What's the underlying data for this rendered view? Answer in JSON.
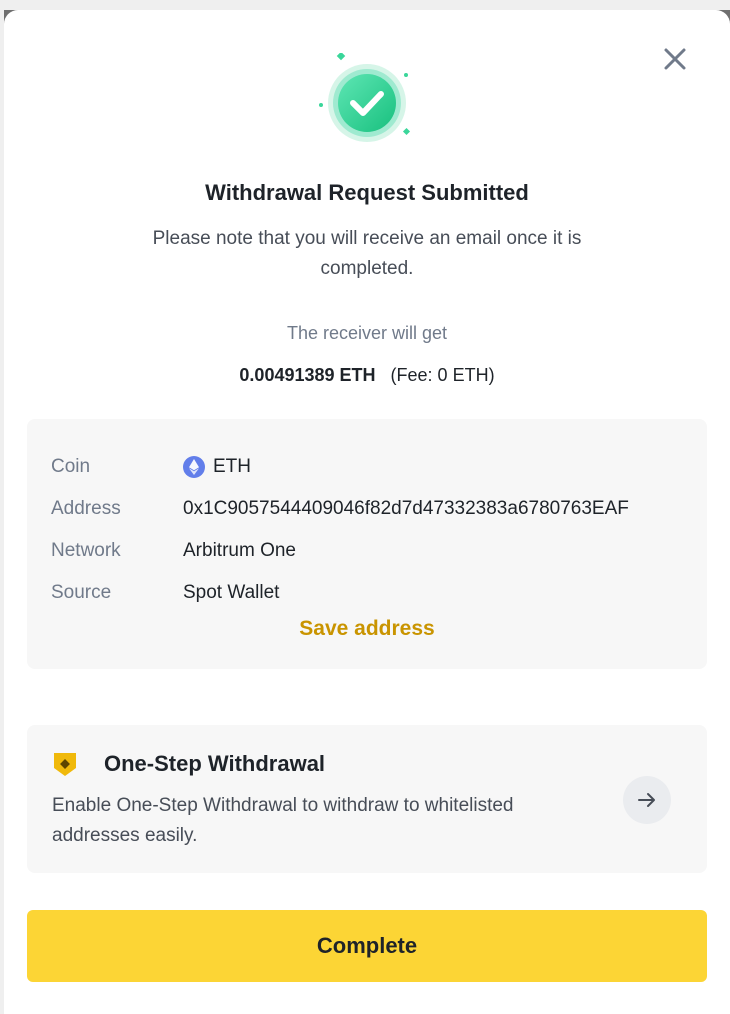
{
  "modal": {
    "title": "Withdrawal Request Submitted",
    "subtitle": "Please note that you will receive an email once it is completed.",
    "receiver_label": "The receiver will get",
    "amount": "0.00491389 ETH",
    "fee": "(Fee: 0 ETH)"
  },
  "details": {
    "rows": [
      {
        "key": "Coin",
        "value": "ETH"
      },
      {
        "key": "Address",
        "value": "0x1C9057544409046f82d7d47332383a6780763EAF"
      },
      {
        "key": "Network",
        "value": "Arbitrum One"
      },
      {
        "key": "Source",
        "value": "Spot Wallet"
      }
    ],
    "save_address_label": "Save address"
  },
  "onestep": {
    "heading": "One-Step Withdrawal",
    "description": "Enable One-Step Withdrawal to withdraw to whitelisted addresses easily."
  },
  "actions": {
    "complete_label": "Complete"
  },
  "icons": {
    "success": "check-circle-icon",
    "close": "close-icon",
    "coin": "ethereum-icon",
    "onestep": "shield-icon",
    "arrow": "arrow-right-icon"
  },
  "colors": {
    "accent_yellow": "#FCD535",
    "link_gold": "#C99400",
    "success_green": "#2ebd85",
    "eth_purple": "#627EEA"
  }
}
